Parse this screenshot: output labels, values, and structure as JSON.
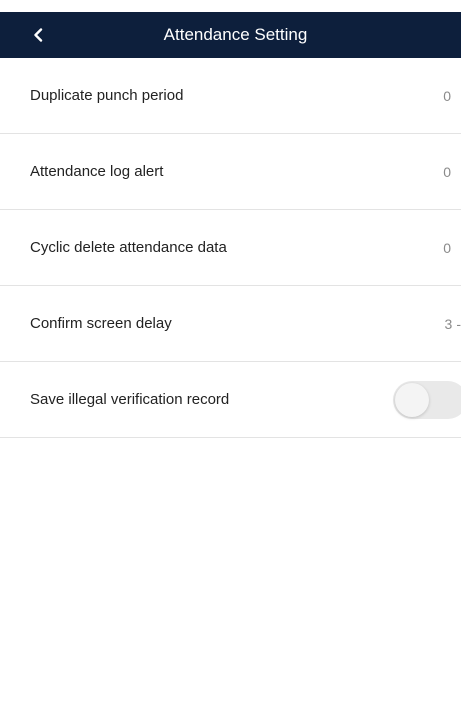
{
  "header": {
    "title": "Attendance Setting",
    "background": "#0d1f3c"
  },
  "settings": [
    {
      "label": "Duplicate punch period",
      "value": "0"
    },
    {
      "label": "Attendance log alert",
      "value": "0"
    },
    {
      "label": "Cyclic delete attendance data",
      "value": "0"
    },
    {
      "label": "Confirm screen delay",
      "value": "3",
      "unit": "-"
    },
    {
      "label": "Save illegal verification record",
      "toggle": false
    }
  ]
}
